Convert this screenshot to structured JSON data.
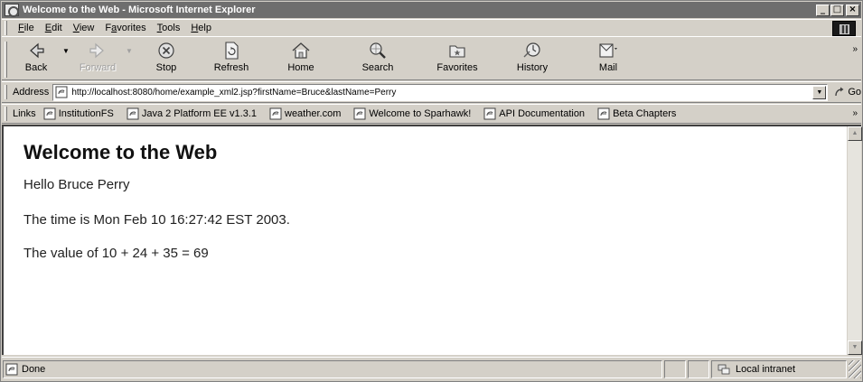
{
  "window": {
    "title": "Welcome to the Web - Microsoft Internet Explorer",
    "controls": {
      "minimize": "_",
      "maximize": "□",
      "close": "×"
    }
  },
  "menu": [
    {
      "label": "File",
      "accel": "F"
    },
    {
      "label": "Edit",
      "accel": "E"
    },
    {
      "label": "View",
      "accel": "V"
    },
    {
      "label": "Favorites",
      "accel": "a"
    },
    {
      "label": "Tools",
      "accel": "T"
    },
    {
      "label": "Help",
      "accel": "H"
    }
  ],
  "toolbar": {
    "back": "Back",
    "forward": "Forward",
    "stop": "Stop",
    "refresh": "Refresh",
    "home": "Home",
    "search": "Search",
    "favorites": "Favorites",
    "history": "History",
    "mail": "Mail"
  },
  "address": {
    "label": "Address",
    "url": "http://localhost:8080/home/example_xml2.jsp?firstName=Bruce&lastName=Perry",
    "go": "Go"
  },
  "links": {
    "label": "Links",
    "items": [
      "InstitutionFS",
      "Java 2 Platform EE v1.3.1",
      "weather.com",
      "Welcome to Sparhawk!",
      "API Documentation",
      "Beta Chapters"
    ]
  },
  "page": {
    "heading": "Welcome to the Web",
    "greeting": "Hello Bruce Perry",
    "time": "The time is Mon Feb 10 16:27:42 EST 2003.",
    "sum": "The value of 10 + 24 + 35 = 69"
  },
  "status": {
    "text": "Done",
    "zone": "Local intranet"
  }
}
